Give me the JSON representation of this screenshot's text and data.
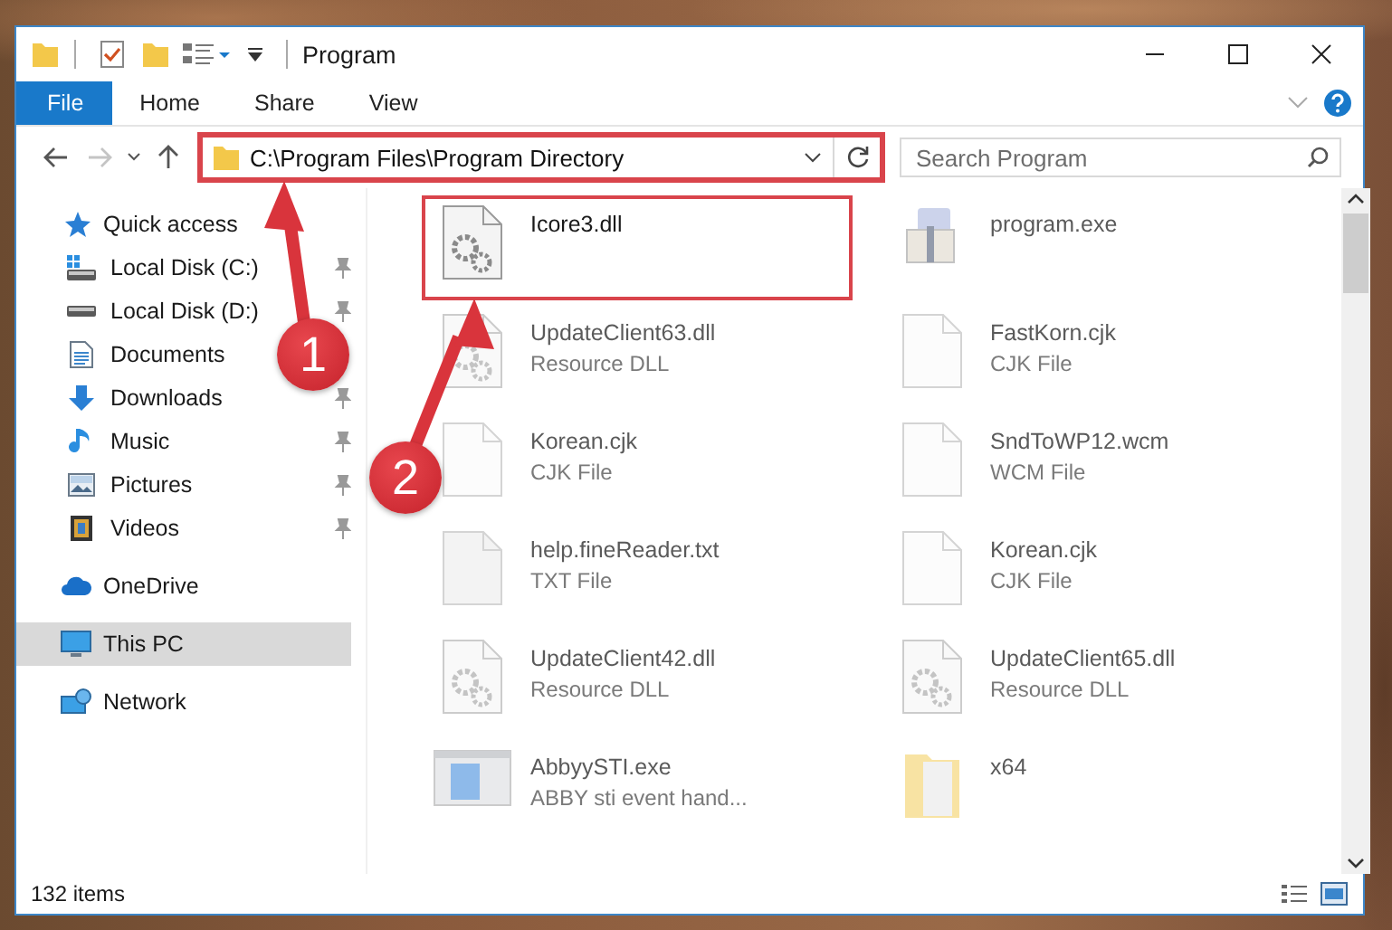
{
  "window": {
    "title": "Program"
  },
  "ribbon_tabs": [
    {
      "label": "File",
      "kind": "file"
    },
    {
      "label": "Home",
      "kind": "tab"
    },
    {
      "label": "Share",
      "kind": "tab"
    },
    {
      "label": "View",
      "kind": "tab"
    }
  ],
  "address_bar": {
    "path": "C:\\Program Files\\Program Directory",
    "highlighted": true
  },
  "search": {
    "placeholder": "Search Program"
  },
  "nav_pane": {
    "items": [
      {
        "label": "Quick access",
        "kind": "star",
        "selected": false,
        "children": [
          {
            "label": "Local Disk (C:)",
            "kind": "system-drive",
            "pinned": true,
            "selected": false
          },
          {
            "label": "Local Disk (D:)",
            "kind": "drive",
            "pinned": true,
            "selected": false
          },
          {
            "label": "Documents",
            "kind": "documents",
            "pinned": false,
            "selected": false
          },
          {
            "label": "Downloads",
            "kind": "downloads",
            "pinned": true,
            "selected": false
          },
          {
            "label": "Music",
            "kind": "music",
            "pinned": true,
            "selected": false
          },
          {
            "label": "Pictures",
            "kind": "pictures",
            "pinned": true,
            "selected": false
          },
          {
            "label": "Videos",
            "kind": "videos",
            "pinned": true,
            "selected": false
          }
        ]
      },
      {
        "label": "OneDrive",
        "kind": "cloud",
        "selected": false
      },
      {
        "label": "This PC",
        "kind": "pc",
        "selected": true
      },
      {
        "label": "Network",
        "kind": "network",
        "selected": false
      }
    ]
  },
  "files": [
    {
      "name": "Icore3.dll",
      "kind": "gear",
      "highlighted": true,
      "blurred": false
    },
    {
      "name": "program.exe",
      "kind": "installer",
      "highlighted": false,
      "blurred": true
    },
    {
      "name": "UpdateClient63.dll",
      "type": "Resource DLL",
      "kind": "gear",
      "highlighted": false,
      "blurred": true
    },
    {
      "name": "FastKorn.cjk",
      "type": "CJK File",
      "kind": "blank",
      "highlighted": false,
      "blurred": true
    },
    {
      "name": "Korean.cjk",
      "type": "CJK File",
      "kind": "blank",
      "highlighted": false,
      "blurred": true
    },
    {
      "name": "SndToWP12.wcm",
      "type": "WCM File",
      "kind": "blank",
      "highlighted": false,
      "blurred": true
    },
    {
      "name": "help.fineReader.txt",
      "type": "TXT File",
      "kind": "text",
      "highlighted": false,
      "blurred": true
    },
    {
      "name": "Korean.cjk",
      "type": "CJK File",
      "kind": "blank",
      "highlighted": false,
      "blurred": true
    },
    {
      "name": "UpdateClient42.dll",
      "type": "Resource DLL",
      "kind": "gear",
      "highlighted": false,
      "blurred": true
    },
    {
      "name": "UpdateClient65.dll",
      "type": "Resource DLL",
      "kind": "gear",
      "highlighted": false,
      "blurred": true
    },
    {
      "name": "AbbyySTI.exe",
      "type": "ABBY sti event hand...",
      "kind": "app",
      "highlighted": false,
      "blurred": true
    },
    {
      "name": "x64",
      "kind": "folder",
      "highlighted": false,
      "blurred": true
    }
  ],
  "status_bar": {
    "count": "132 items"
  },
  "callouts": [
    {
      "number": "1"
    },
    {
      "number": "2"
    }
  ]
}
